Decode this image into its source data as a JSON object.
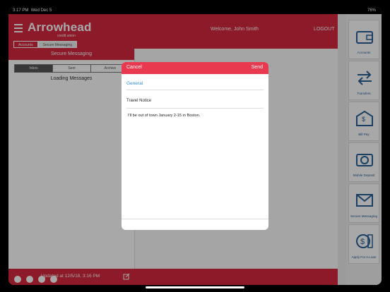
{
  "status_bar": {
    "time": "3:17 PM",
    "date": "Wed Dec 5",
    "battery": "76%"
  },
  "header": {
    "logo_title": "Arrowhead",
    "logo_subtitle": "credit union",
    "welcome": "Welcome, John Smith",
    "logout": "LOGOUT",
    "crumbs": [
      "Accounts",
      "Secure Messaging"
    ]
  },
  "sidebar": {
    "items": [
      {
        "label": "Accounts",
        "icon": "wallet-icon"
      },
      {
        "label": "Transfers",
        "icon": "transfer-arrows-icon"
      },
      {
        "label": "Bill Pay",
        "icon": "envelope-dollar-icon"
      },
      {
        "label": "Mobile Deposit",
        "icon": "camera-icon"
      },
      {
        "label": "Secure Messaging",
        "icon": "mail-icon"
      },
      {
        "label": "Apply For A Loan",
        "icon": "loan-dollar-icon"
      }
    ]
  },
  "messages": {
    "title": "Secure Messaging",
    "segments": [
      "Inbox",
      "Sent",
      "Archive"
    ],
    "loading": "Loading Messages",
    "updated": "Updated at 12/5/18, 3:16 PM"
  },
  "compose": {
    "cancel": "Cancel",
    "send": "Send",
    "category": "General",
    "subject": "Travel Notice",
    "body": "I'll be out of town January 2-15 in Boston."
  },
  "colors": {
    "brand_red": "#d6283e",
    "link_blue": "#2d8bd6",
    "icon_blue": "#2a6096"
  }
}
